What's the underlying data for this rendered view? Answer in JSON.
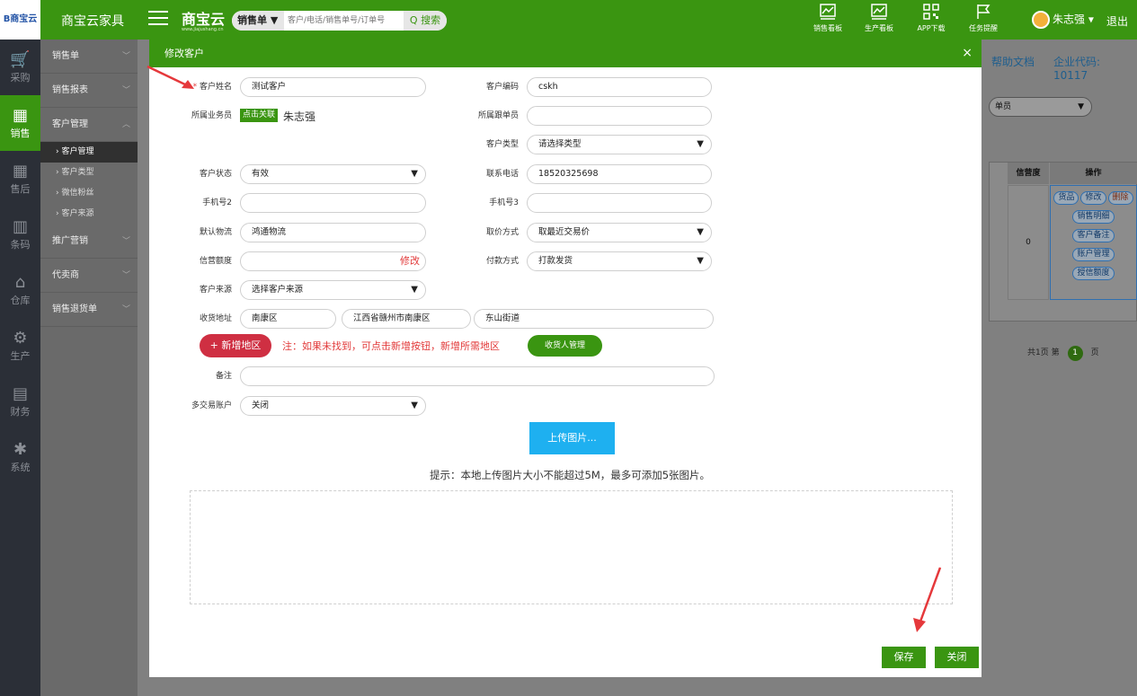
{
  "header": {
    "logo_text": "B商宝云",
    "app_name": "商宝云家具",
    "brand": "商宝云",
    "brand_sub": "www.jiajushang.cn",
    "search_type": "销售单 ▼",
    "search_placeholder": "客户/电话/销售单号/订单号",
    "search_btn": "Q 搜索",
    "top_items": [
      {
        "label": "销售看板",
        "icon": "sales-board-icon"
      },
      {
        "label": "生产看板",
        "icon": "production-board-icon"
      },
      {
        "label": "APP下载",
        "icon": "qrcode-icon"
      },
      {
        "label": "任务提醒",
        "icon": "flag-icon"
      }
    ],
    "user_name": "朱志强 ▾",
    "logout": "退出"
  },
  "leftnav": [
    {
      "label": "采购",
      "icon": "cart-icon",
      "active": false
    },
    {
      "label": "销售",
      "icon": "grid-icon",
      "active": true
    },
    {
      "label": "售后",
      "icon": "grid-icon",
      "active": false
    },
    {
      "label": "条码",
      "icon": "barcode-icon",
      "active": false
    },
    {
      "label": "仓库",
      "icon": "warehouse-icon",
      "active": false
    },
    {
      "label": "生产",
      "icon": "robot-arm-icon",
      "active": false
    },
    {
      "label": "财务",
      "icon": "calculator-icon",
      "active": false
    },
    {
      "label": "系统",
      "icon": "gear-icon",
      "active": false
    }
  ],
  "submenu": {
    "g1": "销售单",
    "g2": "销售报表",
    "g3": "客户管理",
    "leaf1": "› 客户管理",
    "leaf2": "› 客户类型",
    "leaf3": "› 微信粉丝",
    "leaf4": "› 客户来源",
    "g4": "推广营销",
    "g5": "代卖商",
    "g6": "销售退货单"
  },
  "background": {
    "help": "帮助文档",
    "corp": "企业代码: 10117",
    "select": "单员",
    "col_credit": "信营度",
    "col_ops": "操作",
    "credit_value": "0",
    "ops": [
      "货品",
      "修改",
      "删除",
      "销售明细",
      "客户备注",
      "账户管理",
      "授信额度"
    ],
    "pager_total": "共1页  第",
    "pager_num": "1",
    "pager_suffix": "页"
  },
  "modal": {
    "title": "修改客户",
    "close": "×",
    "fields": {
      "name_label": "客户姓名",
      "name_value": "测试客户",
      "code_label": "客户编码",
      "code_value": "cskh",
      "salesman_label": "所属业务员",
      "salesman_tag": "点击关联",
      "salesman_name": "朱志强",
      "follower_label": "所属跟单员",
      "follower_value": "",
      "type_label": "客户类型",
      "type_value": "请选择类型",
      "status_label": "客户状态",
      "status_value": "有效",
      "phone_label": "联系电话",
      "phone_value": "18520325698",
      "phone2_label": "手机号2",
      "phone2_value": "",
      "phone3_label": "手机号3",
      "phone3_value": "",
      "logistics_label": "默认物流",
      "logistics_value": "鸿通物流",
      "price_label": "取价方式",
      "price_value": "取最近交易价",
      "credit_label": "信营额度",
      "credit_value": "",
      "credit_edit": "修改",
      "payment_label": "付款方式",
      "payment_value": "打款发货",
      "source_label": "客户来源",
      "source_value": "选择客户来源",
      "addr_label": "收货地址",
      "addr1": "南康区",
      "addr2": "江西省赣州市南康区",
      "addr3": "东山街道",
      "remark_label": "备注",
      "remark_value": "",
      "multi_label": "多交易账户",
      "multi_value": "关闭"
    },
    "add_region": "+ 新增地区",
    "add_region_note": "注：如果未找到，可点击新增按钮，新增所需地区",
    "receiver_btn": "收货人管理",
    "upload_btn": "上传图片...",
    "hint": "提示：本地上传图片大小不能超过5M，最多可添加5张图片。",
    "save": "保存",
    "close_btn": "关闭"
  },
  "colors": {
    "brand_green": "#3a9511",
    "upload_blue": "#1eb0f0",
    "add_red": "#cf2f42",
    "annotation_red": "#e5383b"
  }
}
